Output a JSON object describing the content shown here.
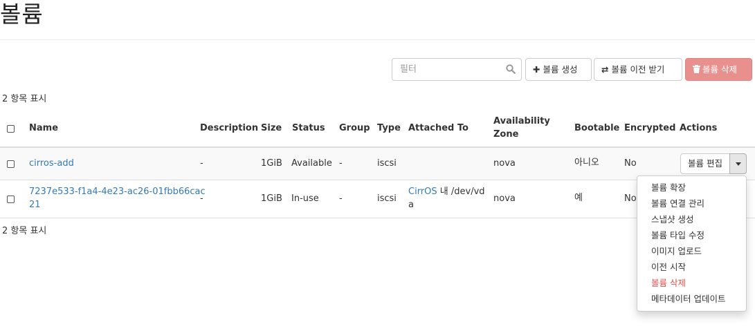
{
  "page": {
    "title": "볼륨"
  },
  "toolbar": {
    "filter_placeholder": "필터",
    "create_label": "볼륨 생성",
    "transfer_label": "볼륨 이전 받기",
    "delete_label": "볼륨 삭제",
    "icons": {
      "filter": "search-icon",
      "create": "plus-icon",
      "transfer": "exchange-icon",
      "delete": "trash-icon"
    }
  },
  "summary": {
    "count_top": "2 항목 표시",
    "count_bottom": "2 항목 표시"
  },
  "table": {
    "headers": {
      "name": "Name",
      "description": "Description",
      "size": "Size",
      "status": "Status",
      "group": "Group",
      "type": "Type",
      "attached_to": "Attached To",
      "availability_line1": "Availability",
      "availability_line2": "Zone",
      "bootable": "Bootable",
      "encrypted": "Encrypted",
      "actions": "Actions"
    },
    "rows": [
      {
        "name": "cirros-add",
        "description": "-",
        "size": "1GiB",
        "status": "Available",
        "group": "-",
        "type": "iscsi",
        "attached_to": "",
        "zone": "nova",
        "bootable": "아니오",
        "encrypted": "No",
        "action": "볼륨 편집"
      },
      {
        "name_line1": "7237e533-f1a4-4e23-ac26-01fbb66cac",
        "name_line2": "21",
        "description": "-",
        "size": "1GiB",
        "status": "In-use",
        "group": "-",
        "type": "iscsi",
        "attached_link": "CirrOS",
        "attached_rest1": " 내 /dev/vd",
        "attached_rest2": "a",
        "zone": "nova",
        "bootable": "예",
        "encrypted": "No"
      }
    ]
  },
  "action_menu": {
    "items": [
      "볼륨 확장",
      "볼륨 연결 관리",
      "스냅샷 생성",
      "볼륨 타입 수정",
      "이미지 업로드",
      "이전 시작",
      "볼륨 삭제",
      "메타데이터 업데이트"
    ]
  },
  "colors": {
    "link": "#337ab7",
    "danger": "#d9534f",
    "delete_button": "#e8908e"
  }
}
